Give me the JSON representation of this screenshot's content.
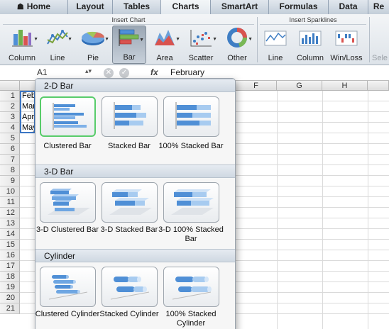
{
  "ribbon_tabs": [
    {
      "label": "Home",
      "active": false
    },
    {
      "label": "Layout",
      "active": false
    },
    {
      "label": "Tables",
      "active": false
    },
    {
      "label": "Charts",
      "active": true
    },
    {
      "label": "SmartArt",
      "active": false
    },
    {
      "label": "Formulas",
      "active": false
    },
    {
      "label": "Data",
      "active": false
    },
    {
      "label": "Re",
      "active": false
    }
  ],
  "insert_chart": {
    "title": "Insert Chart",
    "buttons": [
      {
        "label": "Column",
        "icon": "column-chart-icon"
      },
      {
        "label": "Line",
        "icon": "line-chart-icon"
      },
      {
        "label": "Pie",
        "icon": "pie-chart-icon"
      },
      {
        "label": "Bar",
        "icon": "bar-chart-icon",
        "selected": true
      },
      {
        "label": "Area",
        "icon": "area-chart-icon"
      },
      {
        "label": "Scatter",
        "icon": "scatter-chart-icon"
      },
      {
        "label": "Other",
        "icon": "other-chart-icon"
      }
    ]
  },
  "insert_sparklines": {
    "title": "Insert Sparklines",
    "buttons": [
      {
        "label": "Line",
        "icon": "sparkline-line-icon"
      },
      {
        "label": "Column",
        "icon": "sparkline-column-icon"
      },
      {
        "label": "Win/Loss",
        "icon": "sparkline-winloss-icon"
      }
    ]
  },
  "ribbon_cut_label": "Sele",
  "formula_bar": {
    "name_box": "A1",
    "fx": "fx",
    "value": "February"
  },
  "columns": [
    "F",
    "G",
    "H"
  ],
  "rows": [
    "1",
    "2",
    "3",
    "4",
    "5",
    "6",
    "7",
    "8",
    "9",
    "10",
    "11",
    "12",
    "13",
    "14",
    "15",
    "16",
    "17",
    "18",
    "19",
    "20",
    "21"
  ],
  "cells_col_a": [
    "Feb",
    "Mar",
    "Apr",
    "May"
  ],
  "gallery": {
    "sections": [
      {
        "title": "2-D Bar",
        "items": [
          {
            "label": "Clustered Bar",
            "icon": "clustered-bar-icon",
            "selected": true
          },
          {
            "label": "Stacked Bar",
            "icon": "stacked-bar-icon"
          },
          {
            "label": "100% Stacked Bar",
            "icon": "percent-stacked-bar-icon"
          }
        ]
      },
      {
        "title": "3-D Bar",
        "items": [
          {
            "label": "3-D Clustered Bar",
            "icon": "3d-clustered-bar-icon"
          },
          {
            "label": "3-D Stacked Bar",
            "icon": "3d-stacked-bar-icon"
          },
          {
            "label": "3-D 100% Stacked Bar",
            "icon": "3d-percent-stacked-bar-icon"
          }
        ]
      },
      {
        "title": "Cylinder",
        "items": [
          {
            "label": "Clustered Cylinder",
            "icon": "clustered-cylinder-icon"
          },
          {
            "label": "Stacked Cylinder",
            "icon": "stacked-cylinder-icon"
          },
          {
            "label": "100% Stacked Cylinder",
            "icon": "percent-stacked-cylinder-icon"
          }
        ]
      }
    ]
  },
  "colors": {
    "selection_outline": "#3c76c4",
    "selected_thumb_border": "#58cc6a",
    "bar_blue": "#4f8fd6"
  }
}
